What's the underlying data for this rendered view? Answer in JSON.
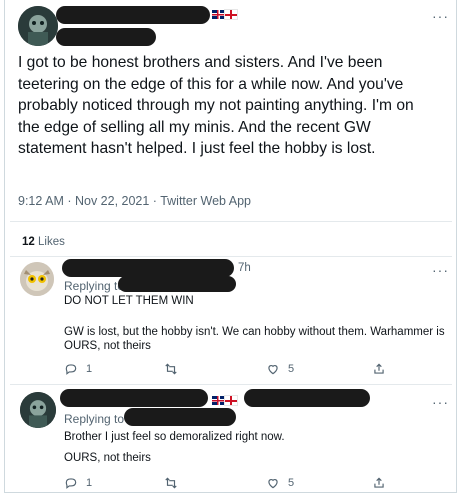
{
  "main_tweet": {
    "text": "I got to be honest brothers and sisters. And I've been teetering on the edge of this for a while now. And you've probably noticed through my not painting anything. I'm on the edge of selling all my minis. And the recent GW statement hasn't helped. I just feel the hobby is lost.",
    "meta": "9:12 AM · Nov 22, 2021 · Twitter Web App",
    "likes_count": "12",
    "likes_label": "Likes"
  },
  "replies": [
    {
      "time": "7h",
      "replying_label": "Replying to",
      "lines": [
        "DO NOT LET THEM WIN",
        "GW is lost, but the hobby isn't. We can hobby without them. Warhammer is OURS, not theirs"
      ],
      "reply_count": "1",
      "like_count": "5"
    },
    {
      "replying_label": "Replying to",
      "lines": [
        "Brother I just feel so demoralized right now.",
        "OURS, not theirs"
      ],
      "reply_count": "1",
      "like_count": "5"
    }
  ],
  "more_glyph": "···",
  "icons": [
    "reply-icon",
    "retweet-icon",
    "like-icon",
    "share-icon",
    "more-icon"
  ]
}
